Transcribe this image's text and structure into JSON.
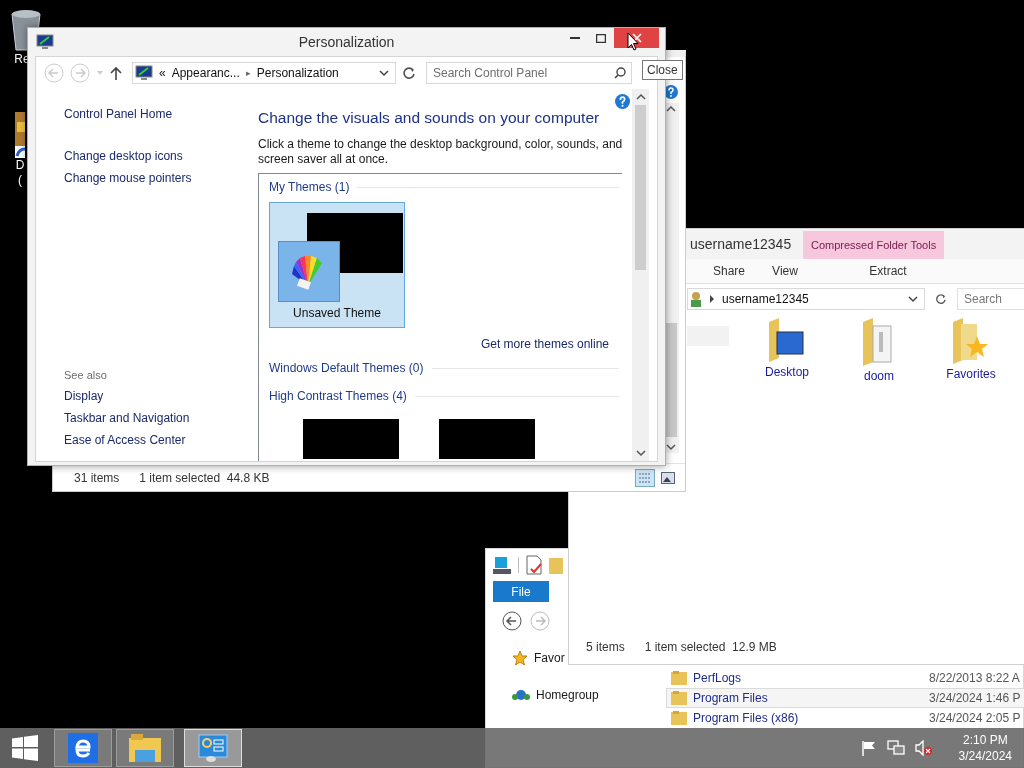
{
  "desktop_icons": [
    {
      "kind": "recycle-bin",
      "lines": [
        "Re"
      ]
    },
    {
      "kind": "shortcut",
      "lines": [
        "D",
        "("
      ]
    }
  ],
  "this_pc_window": {
    "file_tab": "File",
    "nav_items": [
      {
        "kind": "favorites",
        "label": "Favor"
      },
      {
        "kind": "homegroup",
        "label": "Homegroup"
      }
    ],
    "files": [
      {
        "name": "PerfLogs",
        "date": "8/22/2013 8:22 A",
        "selected": false
      },
      {
        "name": "Program Files",
        "date": "3/24/2024 1:46 P",
        "selected": true
      },
      {
        "name": "Program Files (x86)",
        "date": "3/24/2024 2:05 P",
        "selected": false
      }
    ]
  },
  "user_folder_window": {
    "title": "username12345",
    "contextual_tab": "Compressed Folder Tools",
    "ribbon_tabs": [
      "Share",
      "View",
      "Extract"
    ],
    "address": "username12345",
    "search": {
      "placeholder": "Search"
    },
    "items": [
      {
        "kind": "desktop",
        "label": "Desktop"
      },
      {
        "kind": "documents",
        "label": "doom"
      },
      {
        "kind": "favorites",
        "label": "Favorites"
      }
    ],
    "status_bar": {
      "count": "5 items",
      "selection": "1 item selected  12.9 MB"
    }
  },
  "back_window": {
    "status_bar": {
      "count": "31 items",
      "selection": "1 item selected  44.8 KB"
    }
  },
  "personalization_window": {
    "title": "Personalization",
    "close_hovered": true,
    "address": {
      "prefix": "«",
      "crumbs": [
        "Appearanc...",
        "Personalization"
      ],
      "separator": "▸"
    },
    "search": {
      "placeholder": "Search Control Panel"
    },
    "home_link": "Control Panel Home",
    "task_links": [
      "Change desktop icons",
      "Change mouse pointers"
    ],
    "see_also": {
      "heading": "See also",
      "links": [
        "Display",
        "Taskbar and Navigation",
        "Ease of Access Center"
      ]
    },
    "heading": "Change the visuals and sounds on your computer",
    "description": "Click a theme to change the desktop background, color, sounds, and screen saver all at once.",
    "my_themes": {
      "heading": "My Themes (1)",
      "themes": [
        {
          "name": "Unsaved Theme",
          "selected": true
        }
      ]
    },
    "more_link": "Get more themes online",
    "default_themes": {
      "heading": "Windows Default Themes (0)"
    },
    "high_contrast": {
      "heading": "High Contrast Themes (4)"
    }
  },
  "tooltip": "Close",
  "taskbar": {
    "apps": [
      {
        "kind": "browser",
        "selected": false
      },
      {
        "kind": "explorer",
        "selected": false
      },
      {
        "kind": "control-panel",
        "selected": true
      }
    ],
    "clock": {
      "time": "2:10 PM",
      "date": "3/24/2024"
    }
  }
}
